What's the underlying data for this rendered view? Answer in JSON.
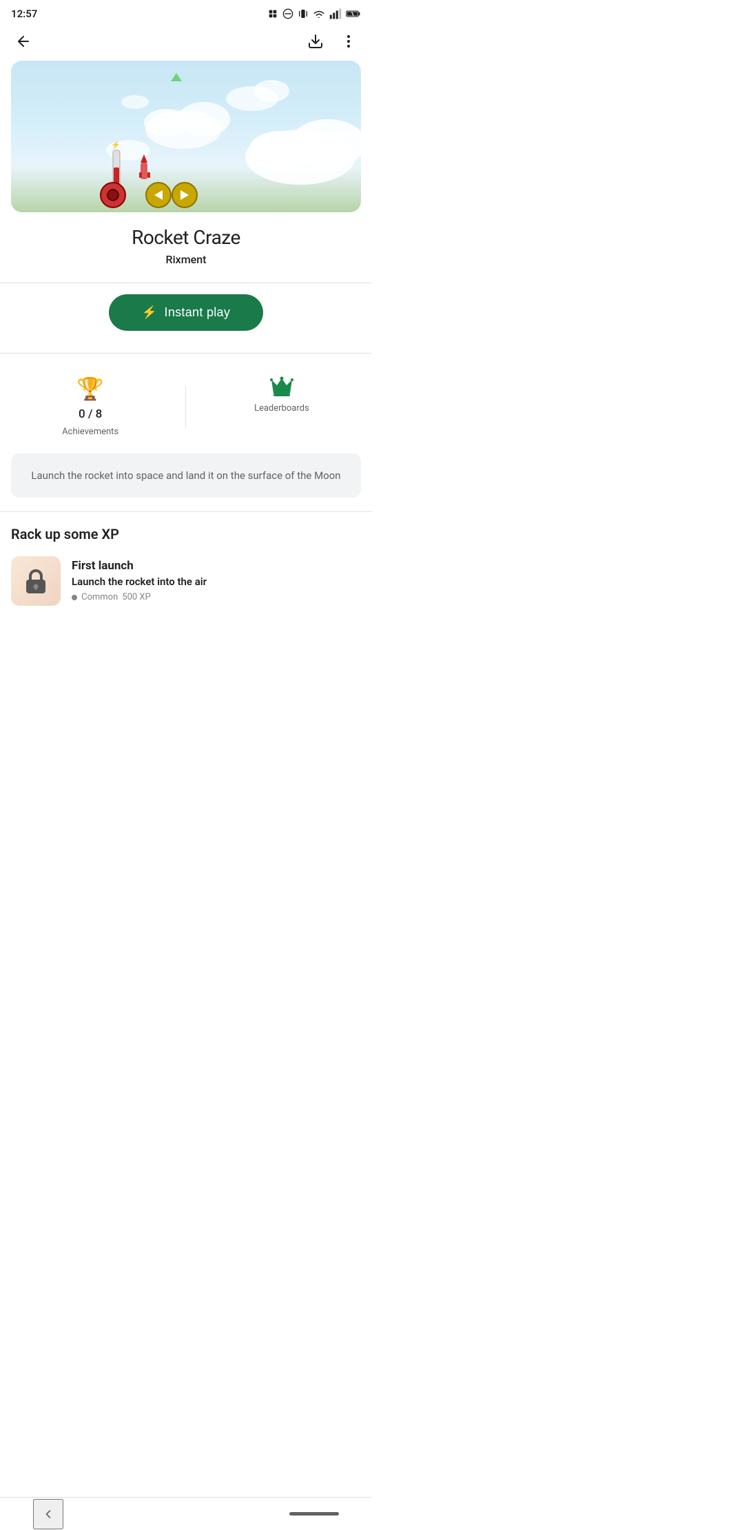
{
  "statusBar": {
    "time": "12:57",
    "icons": [
      "notification-icon",
      "no-disturb-icon",
      "vibrate-icon",
      "wifi-icon",
      "signal-icon",
      "battery-icon"
    ]
  },
  "nav": {
    "backLabel": "←",
    "downloadLabel": "⬇",
    "moreLabel": "⋮"
  },
  "hero": {
    "altText": "Rocket Craze game screenshot"
  },
  "appInfo": {
    "title": "Rocket Craze",
    "developer": "Rixment"
  },
  "instantPlay": {
    "label": "Instant play",
    "lightningIcon": "⚡"
  },
  "stats": {
    "achievements": {
      "icon": "🏆",
      "value": "0 / 8",
      "label": "Achievements"
    },
    "leaderboards": {
      "icon": "👑",
      "label": "Leaderboards"
    }
  },
  "description": {
    "text": "Launch the rocket into space and land it on the surface of the Moon"
  },
  "xpSection": {
    "title": "Rack up some XP",
    "achievements": [
      {
        "name": "First launch",
        "desc": "Launch the rocket into the air",
        "rarity": "Common",
        "xp": "500 XP"
      }
    ]
  },
  "bottomNav": {
    "backLabel": "<"
  }
}
